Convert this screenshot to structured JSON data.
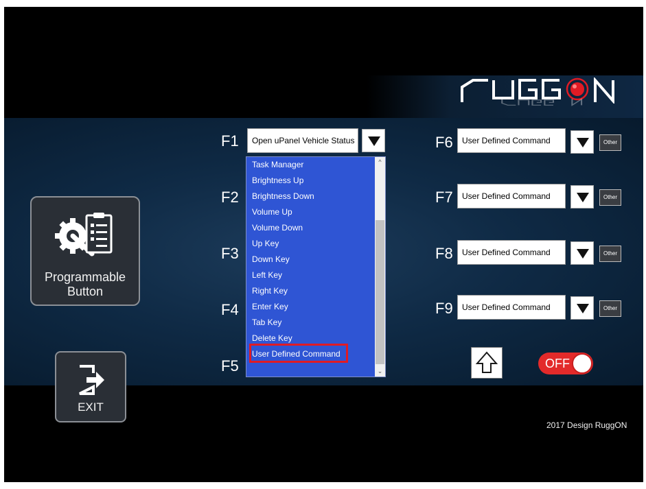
{
  "brand": {
    "logo_text": "RUGGON",
    "accent_color": "#e01b24"
  },
  "programmable_button": {
    "label_line1": "Programmable",
    "label_line2": "Button"
  },
  "exit_button": {
    "label": "EXIT"
  },
  "function_keys": {
    "f1": {
      "label": "F1",
      "value": "Open uPanel Vehicle Status"
    },
    "f2": {
      "label": "F2"
    },
    "f3": {
      "label": "F3"
    },
    "f4": {
      "label": "F4"
    },
    "f5": {
      "label": "F5"
    },
    "f6": {
      "label": "F6",
      "value": "User Defined Command",
      "other": "Other"
    },
    "f7": {
      "label": "F7",
      "value": "User Defined Command",
      "other": "Other"
    },
    "f8": {
      "label": "F8",
      "value": "User Defined Command",
      "other": "Other"
    },
    "f9": {
      "label": "F9",
      "value": "User Defined Command",
      "other": "Other"
    }
  },
  "dropdown": {
    "items": [
      "Task Manager",
      "Brightness Up",
      "Brightness Down",
      "Volume Up",
      "Volume Down",
      "Up Key",
      "Down Key",
      "Left Key",
      "Right Key",
      "Enter Key",
      "Tab Key",
      "Delete Key",
      "User Defined Command"
    ],
    "highlighted": "User Defined Command"
  },
  "toggle": {
    "label": "OFF"
  },
  "footer": {
    "text": "2017 Design RuggON"
  }
}
